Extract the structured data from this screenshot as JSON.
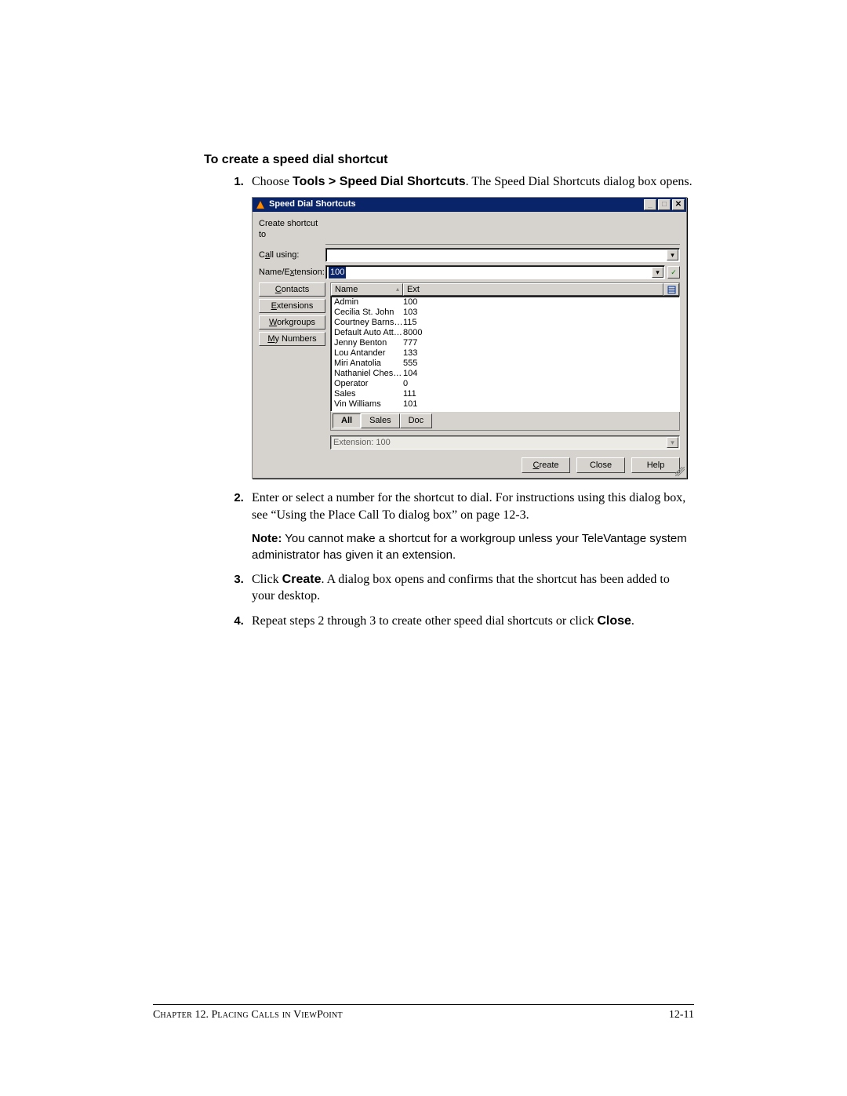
{
  "heading": "To create a speed dial shortcut",
  "steps": {
    "s1_pre": "Choose ",
    "s1_bold": "Tools > Speed Dial Shortcuts",
    "s1_post": ". The Speed Dial Shortcuts dialog box opens.",
    "s2": "Enter or select a number for the shortcut to dial. For instructions using this dialog box, see “Using the Place Call To dialog box” on page 12-3.",
    "s2_note_label": "Note:",
    "s2_note_body": "  You cannot make a shortcut for a workgroup unless your TeleVantage system administrator has given it an extension.",
    "s3_pre": "Click ",
    "s3_bold": "Create",
    "s3_post": ". A dialog box opens and confirms that the shortcut has been added to your desktop.",
    "s4_pre": "Repeat steps 2 through 3 to create other speed dial shortcuts or click ",
    "s4_bold": "Close",
    "s4_post": "."
  },
  "dialog": {
    "title": "Speed Dial Shortcuts",
    "labels": {
      "create_to": "Create shortcut to",
      "call_using_pre": "C",
      "call_using_ul": "a",
      "call_using_post": "ll using:",
      "name_ext_pre": "Name/E",
      "name_ext_ul": "x",
      "name_ext_post": "tension:",
      "contacts_ul": "C",
      "contacts_post": "ontacts",
      "extensions_ul": "E",
      "extensions_post": "xtensions",
      "workgroups_ul": "W",
      "workgroups_post": "orkgroups",
      "mynum_pre": "",
      "mynum_ul": "M",
      "mynum_post": "y Numbers",
      "col_name": "Name",
      "col_ext": "Ext",
      "tab_all": "All",
      "tab_sales": "Sales",
      "tab_doc": "Doc",
      "ext_display": "Extension: 100",
      "btn_create_ul": "C",
      "btn_create_post": "reate",
      "btn_close": "Close",
      "btn_help": "Help"
    },
    "name_ext_value": "100",
    "rows": [
      {
        "name": "Admin",
        "ext": "100"
      },
      {
        "name": "Cecilia St. John",
        "ext": "103"
      },
      {
        "name": "Courtney Barnstable",
        "ext": "115"
      },
      {
        "name": "Default Auto Atten…",
        "ext": "8000"
      },
      {
        "name": "Jenny Benton",
        "ext": "777"
      },
      {
        "name": "Lou Antander",
        "ext": "133"
      },
      {
        "name": "Miri Anatolia",
        "ext": "555"
      },
      {
        "name": "Nathaniel Chestnut",
        "ext": "104"
      },
      {
        "name": "Operator",
        "ext": "0"
      },
      {
        "name": "Sales",
        "ext": "111"
      },
      {
        "name": "Vin Williams",
        "ext": "101"
      }
    ]
  },
  "footer": {
    "chapter_pre": "C",
    "chapter_sc": "hapter",
    "num": " 12. ",
    "title_pre1": "P",
    "title_sc1": "lacing",
    "title_pre2": " C",
    "title_sc2": "alls in",
    "title_pre3": " V",
    "title_sc3": "iew",
    "title_pre4": "P",
    "title_sc4": "oint",
    "pagenum": "12-11"
  }
}
